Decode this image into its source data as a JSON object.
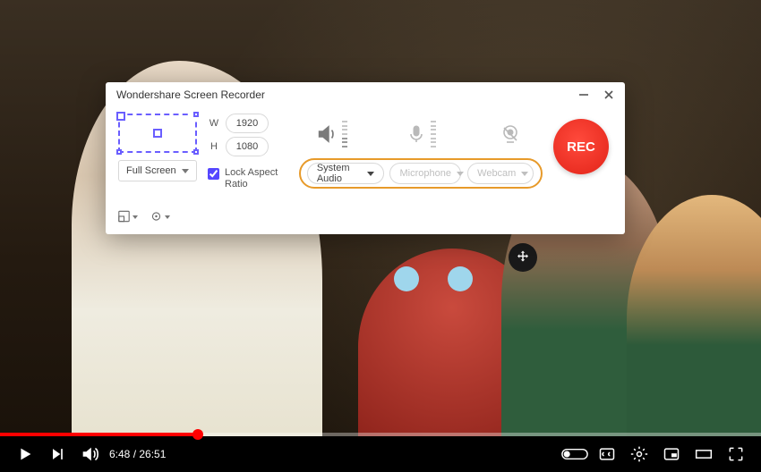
{
  "panel": {
    "title": "Wondershare Screen Recorder",
    "plus": "+",
    "width_label": "W",
    "width_value": "1920",
    "height_label": "H",
    "height_value": "1080",
    "mode_label": "Full Screen",
    "lock_label": "Lock Aspect Ratio",
    "sources": {
      "system_audio": "System Audio",
      "microphone": "Microphone",
      "webcam": "Webcam"
    },
    "rec_label": "REC"
  },
  "player": {
    "time": "6:48 / 26:51"
  }
}
